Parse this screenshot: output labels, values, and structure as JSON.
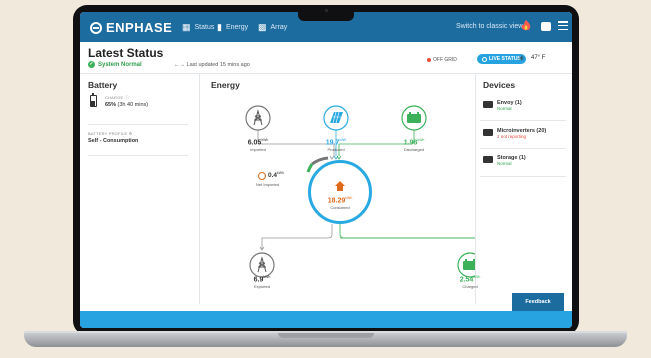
{
  "header": {
    "brand": "ENPHASE",
    "nav": [
      {
        "label": "Status",
        "icon": "grid-icon"
      },
      {
        "label": "Energy",
        "icon": "bar-chart-icon"
      },
      {
        "label": "Array",
        "icon": "solar-array-icon"
      }
    ],
    "classic_view": "Switch to classic view"
  },
  "status": {
    "title": "Latest Status",
    "system": "System Normal",
    "updated": "←→ Last updated 15 mins ago",
    "grid": "OFF GRID",
    "live": "LIVE STATUS",
    "temperature": "47° F"
  },
  "battery": {
    "heading": "Battery",
    "charge_label": "CHARGE",
    "charge_pct": "65%",
    "charge_time": "(3h 40 mins)",
    "profile_label": "BATTERY PROFILE",
    "profile_value": "Self - Consumption"
  },
  "energy": {
    "heading": "Energy",
    "unit": "kWh",
    "imported": {
      "value": "6.05",
      "label": "Imported"
    },
    "produced": {
      "value": "19.7",
      "label": "Produced"
    },
    "discharged": {
      "value": "1.98",
      "label": "Discharged"
    },
    "consumed": {
      "value": "18.29",
      "label": "Consumed"
    },
    "net_imported": {
      "value": "0.4",
      "label": "Net Imported"
    },
    "exported": {
      "value": "6.9",
      "label": "Exported"
    },
    "charged": {
      "value": "2.54",
      "label": "Charged"
    }
  },
  "devices": {
    "heading": "Devices",
    "items": [
      {
        "name": "Envoy (1)",
        "status": "Normal",
        "ok": true
      },
      {
        "name": "Microinverters (20)",
        "status": "2 not reporting",
        "ok": false
      },
      {
        "name": "Storage (1)",
        "status": "Normal",
        "ok": true
      }
    ]
  },
  "feedback": "Feedback",
  "colors": {
    "nav": "#1d6ca0",
    "accent": "#29a9e1",
    "green": "#3cb15a",
    "orange": "#e06a1b",
    "red": "#e74c3c"
  }
}
